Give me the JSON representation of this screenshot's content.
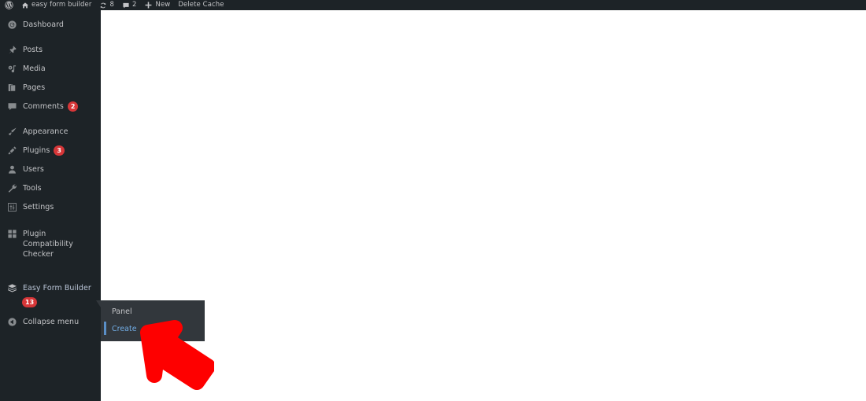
{
  "adminbar": {
    "logo_icon": "wordpress-logo-icon",
    "site": {
      "icon": "home-icon",
      "label": "easy form builder"
    },
    "updates": {
      "icon": "updates-icon",
      "count": "8"
    },
    "comments": {
      "icon": "comment-bubble-icon",
      "count": "2"
    },
    "new": {
      "icon": "plus-icon",
      "label": "New"
    },
    "delete_cache": {
      "label": "Delete Cache"
    }
  },
  "sidebar": {
    "items": [
      {
        "label": "Dashboard",
        "icon": "dashboard-gauge-icon",
        "badge": ""
      },
      {
        "label": "Posts",
        "icon": "pushpin-icon",
        "badge": ""
      },
      {
        "label": "Media",
        "icon": "media-music-icon",
        "badge": ""
      },
      {
        "label": "Pages",
        "icon": "pages-stack-icon",
        "badge": ""
      },
      {
        "label": "Comments",
        "icon": "comment-bubble-icon",
        "badge": "2"
      },
      {
        "label": "Appearance",
        "icon": "paintbrush-icon",
        "badge": ""
      },
      {
        "label": "Plugins",
        "icon": "plug-icon",
        "badge": "3"
      },
      {
        "label": "Users",
        "icon": "user-icon",
        "badge": ""
      },
      {
        "label": "Tools",
        "icon": "wrench-icon",
        "badge": ""
      },
      {
        "label": "Settings",
        "icon": "sliders-icon",
        "badge": ""
      },
      {
        "label": "Plugin Compatibility Checker",
        "icon": "grid-squares-icon",
        "badge": ""
      }
    ],
    "active_plugin": {
      "label": "Easy Form Builder",
      "icon": "layered-box-icon",
      "badge": "13"
    },
    "collapse": {
      "label": "Collapse menu",
      "icon": "collapse-arrow-icon"
    }
  },
  "submenu": {
    "items": [
      {
        "label": "Panel",
        "current": false
      },
      {
        "label": "Create",
        "current": true
      }
    ]
  },
  "annotation": {
    "arrow": "red-arrow-pointing-to-create"
  },
  "colors": {
    "admin_bg": "#1d2327",
    "submenu_bg": "#32373c",
    "badge": "#d63638",
    "current_link": "#72aee6",
    "arrow": "#fe0000"
  }
}
